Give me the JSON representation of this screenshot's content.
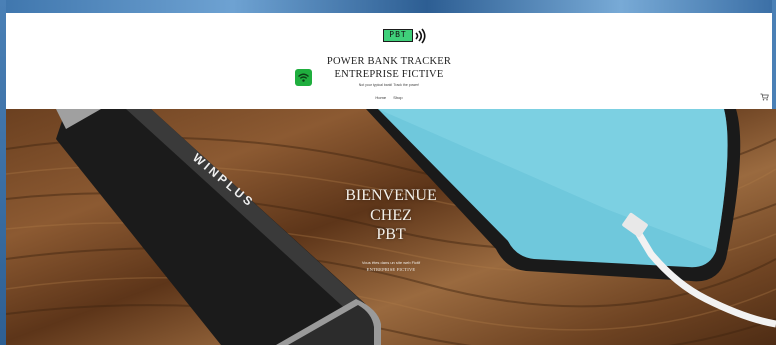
{
  "header": {
    "logo_text": "PBT",
    "title_line1": "POWER BANK TRACKER",
    "title_line2": "ENTREPRISE FICTIVE",
    "tagline": "Not your typical bank! Track the power!"
  },
  "nav": {
    "items": [
      {
        "label": "Home"
      },
      {
        "label": "Shop"
      }
    ]
  },
  "icons": {
    "logo": "battery-signal-icon",
    "wifi": "wifi-icon",
    "cart": "cart-icon"
  },
  "hero": {
    "title_line1": "BIENVENUE",
    "title_line2": "CHEZ",
    "title_line3": "PBT",
    "subtitle": "Vous êtes dans un site web Fictif",
    "subtitle2": "ENTREPRISE FICTIVE",
    "brand_on_powerbank": "WINPLUS"
  },
  "colors": {
    "logo_green": "#3fd07a",
    "wifi_green": "#1fae3e",
    "header_bg": "#ffffff",
    "backdrop_blue": "#4f86b8"
  }
}
